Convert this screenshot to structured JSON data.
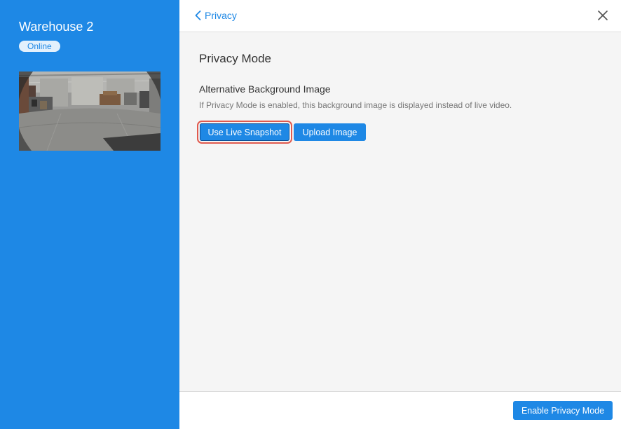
{
  "sidebar": {
    "camera_name": "Warehouse 2",
    "status": "Online",
    "thumbnail_icon": "camera-snapshot"
  },
  "header": {
    "back_label": "Privacy",
    "back_icon": "chevron-left-icon",
    "close_icon": "close-icon"
  },
  "content": {
    "title": "Privacy Mode",
    "subtitle": "Alternative Background Image",
    "description": "If Privacy Mode is enabled, this background image is displayed instead of live video.",
    "buttons": {
      "live_snapshot": "Use Live Snapshot",
      "upload_image": "Upload Image"
    }
  },
  "footer": {
    "enable_label": "Enable Privacy Mode"
  },
  "colors": {
    "accent": "#1e88e5",
    "highlight_outline": "#e05a4e"
  }
}
